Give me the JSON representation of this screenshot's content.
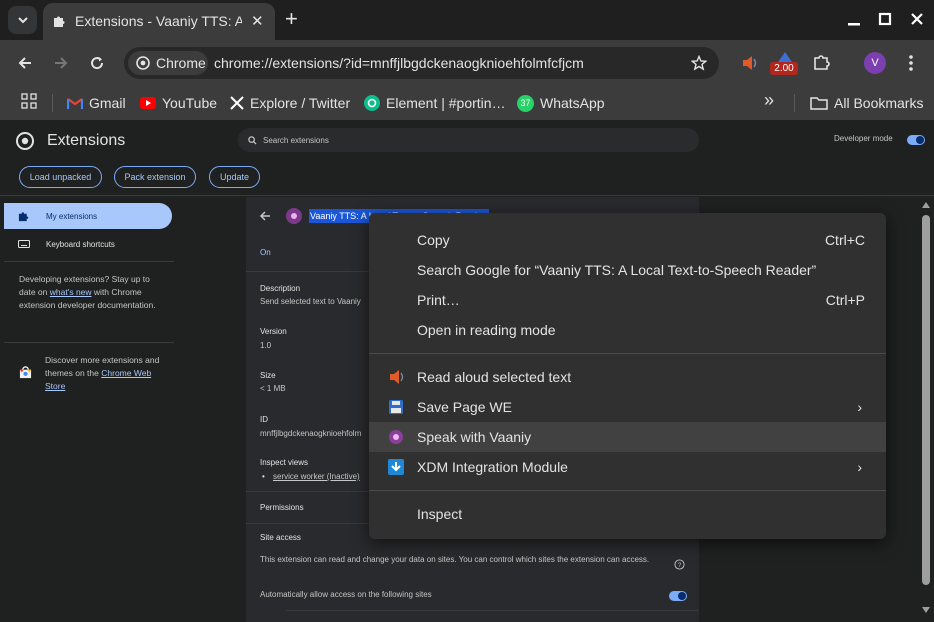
{
  "tabs": {
    "active_title": "Extensions - Vaaniy TTS: A Local Text-to-Speech Reader",
    "close_glyph": "✕",
    "new_tab_glyph": "+"
  },
  "toolbar": {
    "chip_label": "Chrome",
    "url": "chrome://extensions/?id=mnffjlbgdckenaogknioehfolmfcfjcm",
    "speed_badge": "2.00",
    "profile_initial": "V"
  },
  "bookmarks": {
    "items": [
      "Gmail",
      "YouTube",
      "Explore / Twitter",
      "Element | #portin…",
      "WhatsApp"
    ],
    "whatsapp_count": "37",
    "overflow_glyph": "»",
    "all_bookmarks": "All Bookmarks"
  },
  "extensions_page": {
    "title": "Extensions",
    "search_placeholder": "Search extensions",
    "developer_mode_label": "Developer mode",
    "buttons": [
      "Load unpacked",
      "Pack extension",
      "Update"
    ]
  },
  "sidebar": {
    "my_extensions": "My extensions",
    "keyboard_shortcuts": "Keyboard shortcuts",
    "dev_text_1": "Developing extensions? Stay up to date on",
    "dev_link": "what's new",
    "dev_text_2": "with Chrome extension developer documentation.",
    "discover_text": "Discover more extensions and themes on the",
    "store_link": "Chrome Web Store"
  },
  "detail": {
    "name_selected": "Vaaniy TTS: A Local Text-to-Speech Reader",
    "status": "On",
    "description_label": "Description",
    "description_value": "Send selected text to Vaaniy",
    "version_label": "Version",
    "version_value": "1.0",
    "size_label": "Size",
    "size_value": "< 1 MB",
    "id_label": "ID",
    "id_value": "mnffjlbgdckenaogknioehfolm",
    "inspect_label": "Inspect views",
    "inspect_link": "service worker (Inactive)",
    "permissions_label": "Permissions",
    "site_access_label": "Site access",
    "site_access_text": "This extension can read and change your data on sites. You can control which sites the extension can access.",
    "auto_allow_label": "Automatically allow access on the following sites"
  },
  "context_menu": {
    "copy": "Copy",
    "copy_shortcut": "Ctrl+C",
    "search_google": "Search Google for “Vaaniy TTS: A Local Text-to-Speech Reader”",
    "print": "Print…",
    "print_shortcut": "Ctrl+P",
    "reading_mode": "Open in reading mode",
    "read_aloud": "Read aloud selected text",
    "save_page": "Save Page WE",
    "speak_vaaniy": "Speak with Vaaniy",
    "xdm": "XDM Integration Module",
    "inspect": "Inspect",
    "submenu_glyph": "›"
  },
  "colors": {
    "accent": "#a8c7fa",
    "toggle": "#7cacf8",
    "menu_bg": "#303030",
    "highlight": "#414141",
    "selection": "#1a56d6"
  }
}
